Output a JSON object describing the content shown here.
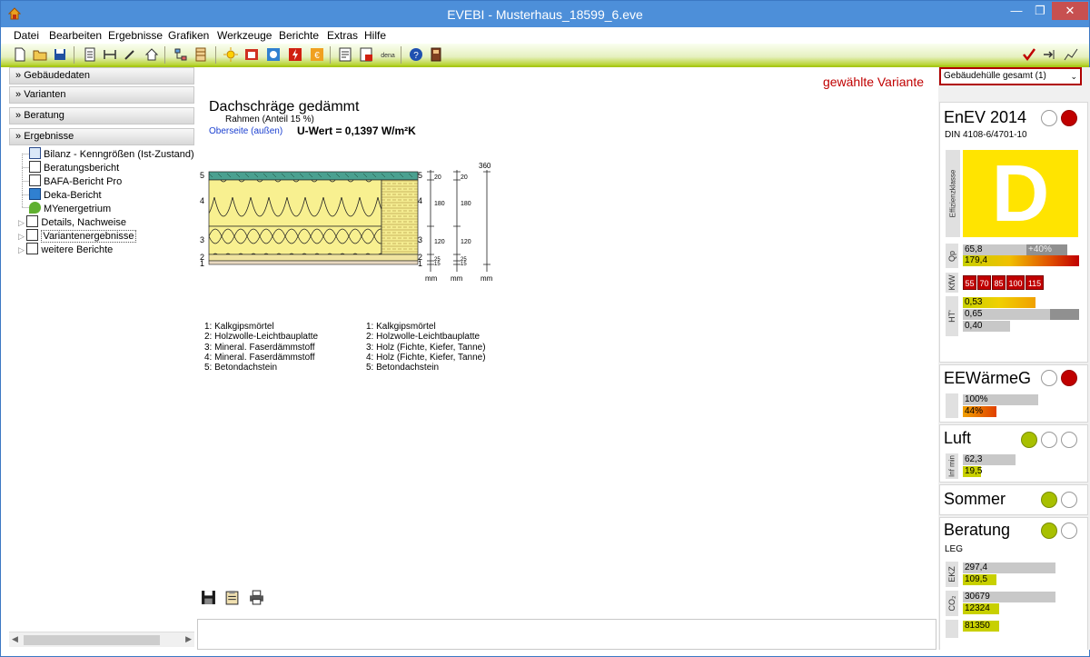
{
  "window": {
    "title": "EVEBI - Musterhaus_18599_6.eve"
  },
  "menu": [
    "Datei",
    "Bearbeiten",
    "Ergebnisse",
    "Grafiken",
    "Werkzeuge",
    "Berichte",
    "Extras",
    "Hilfe"
  ],
  "left": {
    "sections": [
      "Gebäudedaten",
      "Varianten",
      "Beratung",
      "Ergebnisse"
    ],
    "tree": [
      "Bilanz - Kenngrößen (Ist-Zustand)",
      "Beratungsbericht",
      "BAFA-Bericht Pro",
      "Deka-Bericht",
      "MYenergetrium",
      "Details, Nachweise",
      "Variantenergebnisse",
      "weitere Berichte"
    ]
  },
  "center": {
    "variant_label": "gewählte Variante",
    "title": "Dachschräge gedämmt",
    "subtitle": "Rahmen (Anteil 15 %)",
    "link": "Oberseite (außen)",
    "uwert": "U-Wert = 0,1397 W/m²K",
    "layer_numbers": [
      "5",
      "4",
      "3",
      "2",
      "1"
    ],
    "dim_top": "360",
    "dims_a": [
      "20",
      "180",
      "120",
      "25",
      "15"
    ],
    "dims_b": [
      "20",
      "180",
      "120",
      "25",
      "15"
    ],
    "unit": "mm",
    "legend_left": [
      "1: Kalkgipsmörtel",
      "2: Holzwolle-Leichtbauplatte",
      "3: Mineral. Faserdämmstoff",
      "4: Mineral. Faserdämmstoff",
      "5: Betondachstein"
    ],
    "legend_right": [
      "1: Kalkgipsmörtel",
      "2: Holzwolle-Leichtbauplatte",
      "3: Holz (Fichte, Kiefer, Tanne)",
      "4: Holz (Fichte, Kiefer, Tanne)",
      "5: Betondachstein"
    ]
  },
  "right": {
    "dropdown": "Gebäudehülle gesamt (1)",
    "enev": {
      "title": "EnEV 2014",
      "norm": "DIN 4108-6/4701-10",
      "class_label": "Effizienzklasse",
      "class": "D",
      "qp_label": "Qp",
      "qp": [
        "65,8",
        "+40%",
        "179,4"
      ],
      "kfw_label": "KfW",
      "kfw": [
        "55",
        "70",
        "85",
        "100",
        "115"
      ],
      "ht_label": "HT'",
      "ht": [
        "0,53",
        "0,65",
        "0,40"
      ]
    },
    "eew": {
      "title": "EEWärmeG",
      "values": [
        "100%",
        "44%"
      ]
    },
    "luft": {
      "title": "Luft",
      "label": "Inf min",
      "values": [
        "62,3",
        "19,5"
      ]
    },
    "sommer": {
      "title": "Sommer"
    },
    "beratung": {
      "title": "Beratung",
      "sub": "LEG",
      "ekz_label": "EKZ",
      "ekz": [
        "297,4",
        "109,5"
      ],
      "co2_label": "CO₂",
      "co2": [
        "30679",
        "12324"
      ],
      "last": "81350"
    }
  },
  "colors": {
    "accent": "#4d8fd9",
    "toolbar": "#b6d22a",
    "red": "#c00000",
    "label_yellow": "#ffe400"
  }
}
